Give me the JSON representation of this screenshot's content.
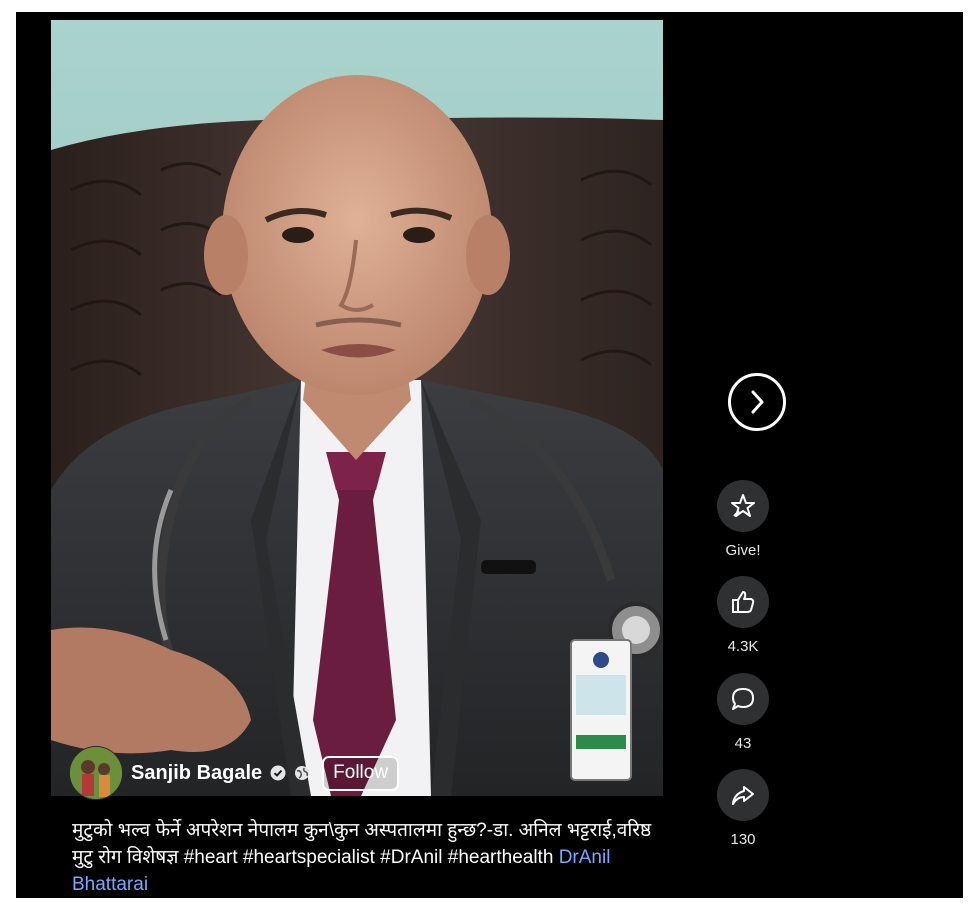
{
  "post": {
    "author_name": "Sanjib Bagale",
    "follow_label": "Follow",
    "caption_text": "मुटुको भल्व फेर्ने अपरेशन नेपालम कुन\\कुन अस्पतालमा हुन्छ?-डा. अनिल भट्टराई,वरिष्ठ मुटु रोग विशेषज्ञ #heart #heartspecialist #DrAnil #hearthealth",
    "caption_link": "DrAnil Bhattarai"
  },
  "actions": {
    "give_label": "Give!",
    "like_count": "4.3K",
    "comment_count": "43",
    "share_count": "130"
  },
  "icons": {
    "next": "chevron-right-icon",
    "give": "star-gift-icon",
    "like": "thumbs-up-icon",
    "comment": "comment-bubble-icon",
    "share": "share-arrow-icon",
    "verified": "verified-badge-icon",
    "audience": "globe-icon"
  }
}
